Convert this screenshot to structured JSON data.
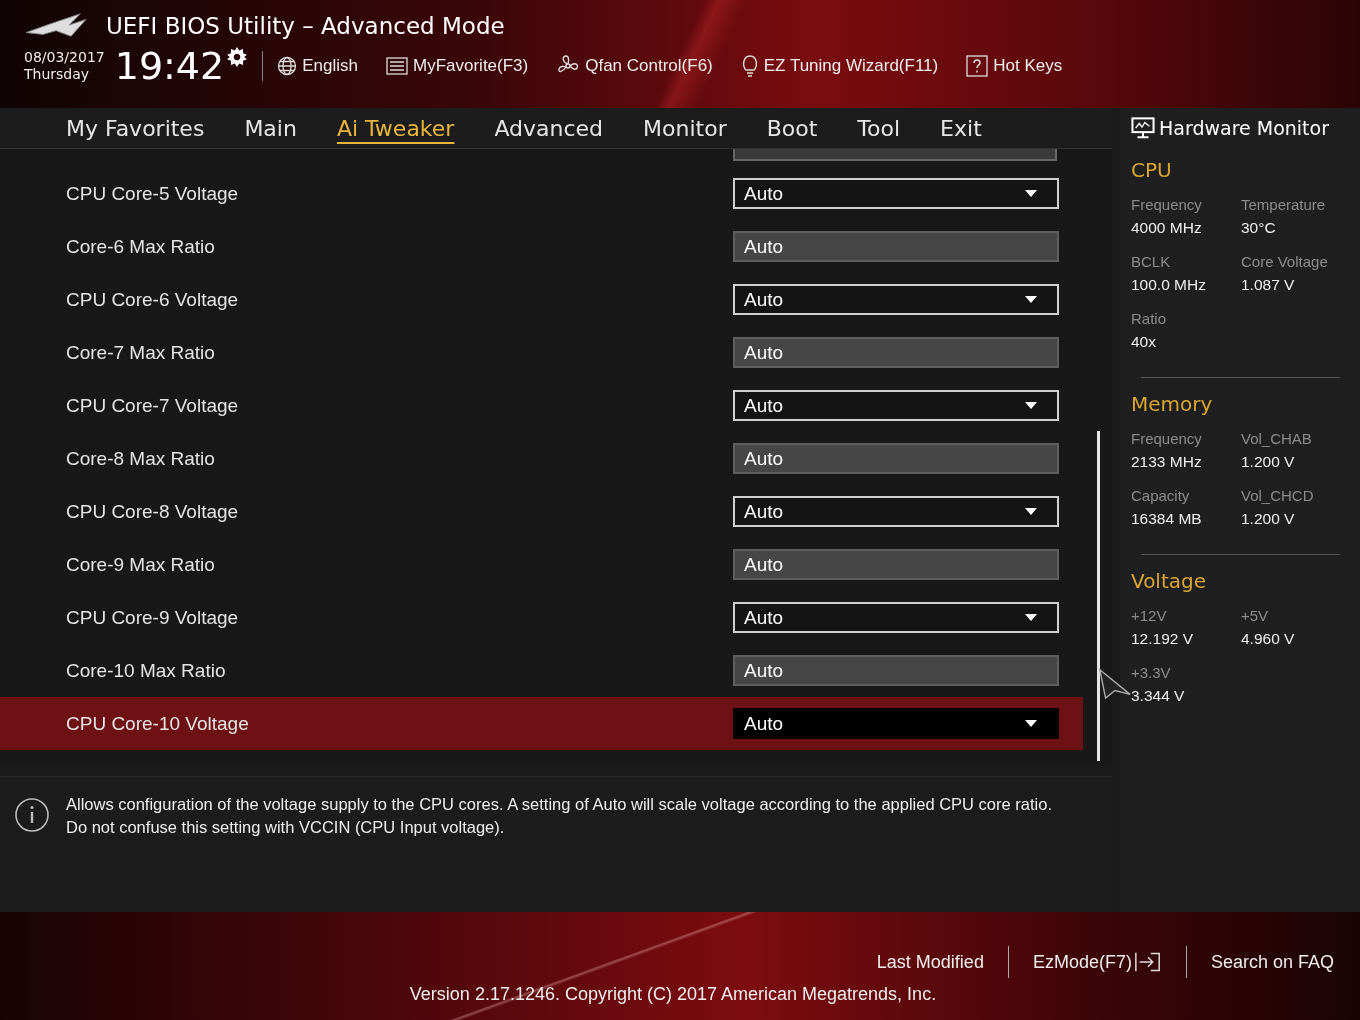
{
  "header": {
    "title": "UEFI BIOS Utility – Advanced Mode",
    "date": "08/03/2017",
    "day": "Thursday",
    "time": "19:42",
    "tools": [
      {
        "kind": "globe",
        "label": "English"
      },
      {
        "kind": "list",
        "label": "MyFavorite(F3)"
      },
      {
        "kind": "fan",
        "label": "Qfan Control(F6)"
      },
      {
        "kind": "bulb",
        "label": "EZ Tuning Wizard(F11)"
      },
      {
        "kind": "help",
        "label": "Hot Keys"
      }
    ]
  },
  "tabs": [
    {
      "label": "My Favorites",
      "selected": false
    },
    {
      "label": "Main",
      "selected": false
    },
    {
      "label": "Ai Tweaker",
      "selected": true
    },
    {
      "label": "Advanced",
      "selected": false
    },
    {
      "label": "Monitor",
      "selected": false
    },
    {
      "label": "Boot",
      "selected": false
    },
    {
      "label": "Tool",
      "selected": false
    },
    {
      "label": "Exit",
      "selected": false
    }
  ],
  "settings": [
    {
      "label": "CPU Core-5 Voltage",
      "kind": "dropdown",
      "value": "Auto",
      "selected": false
    },
    {
      "label": "Core-6 Max Ratio",
      "kind": "input",
      "value": "Auto",
      "selected": false
    },
    {
      "label": "CPU Core-6 Voltage",
      "kind": "dropdown",
      "value": "Auto",
      "selected": false
    },
    {
      "label": "Core-7 Max Ratio",
      "kind": "input",
      "value": "Auto",
      "selected": false
    },
    {
      "label": "CPU Core-7 Voltage",
      "kind": "dropdown",
      "value": "Auto",
      "selected": false
    },
    {
      "label": "Core-8 Max Ratio",
      "kind": "input",
      "value": "Auto",
      "selected": false
    },
    {
      "label": "CPU Core-8 Voltage",
      "kind": "dropdown",
      "value": "Auto",
      "selected": false
    },
    {
      "label": "Core-9 Max Ratio",
      "kind": "input",
      "value": "Auto",
      "selected": false
    },
    {
      "label": "CPU Core-9 Voltage",
      "kind": "dropdown",
      "value": "Auto",
      "selected": false
    },
    {
      "label": "Core-10 Max Ratio",
      "kind": "input",
      "value": "Auto",
      "selected": false
    },
    {
      "label": "CPU Core-10 Voltage",
      "kind": "dropdown",
      "value": "Auto",
      "selected": true
    }
  ],
  "help_text": "Allows configuration of the voltage supply to the CPU cores. A setting of Auto will scale voltage according to the applied CPU core ratio.  Do not confuse this setting with VCCIN (CPU Input voltage).",
  "hardware_monitor": {
    "title": "Hardware Monitor",
    "sections": [
      {
        "title": "CPU",
        "items": [
          {
            "label": "Frequency",
            "value": "4000 MHz"
          },
          {
            "label": "Temperature",
            "value": "30°C"
          },
          {
            "label": "BCLK",
            "value": "100.0 MHz"
          },
          {
            "label": "Core Voltage",
            "value": "1.087 V"
          },
          {
            "label": "Ratio",
            "value": "40x"
          }
        ]
      },
      {
        "title": "Memory",
        "items": [
          {
            "label": "Frequency",
            "value": "2133 MHz"
          },
          {
            "label": "Vol_CHAB",
            "value": "1.200 V"
          },
          {
            "label": "Capacity",
            "value": "16384 MB"
          },
          {
            "label": "Vol_CHCD",
            "value": "1.200 V"
          }
        ]
      },
      {
        "title": "Voltage",
        "items": [
          {
            "label": "+12V",
            "value": "12.192 V"
          },
          {
            "label": "+5V",
            "value": "4.960 V"
          },
          {
            "label": "+3.3V",
            "value": "3.344 V"
          }
        ]
      }
    ]
  },
  "footer": {
    "links": [
      {
        "label": "Last Modified",
        "kind": "text"
      },
      {
        "label": "EzMode(F7)",
        "kind": "exit"
      },
      {
        "label": "Search on FAQ",
        "kind": "text"
      }
    ],
    "version": "Version 2.17.1246. Copyright (C) 2017 American Megatrends, Inc."
  }
}
